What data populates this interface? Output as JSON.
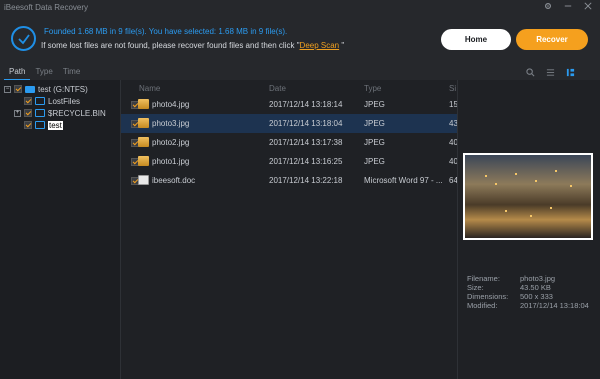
{
  "window": {
    "title": "iBeesoft Data Recovery",
    "controls": [
      "gear-icon",
      "minimize-icon",
      "close-icon"
    ]
  },
  "header": {
    "found_text": "Founded 1.68 MB in 9 file(s).   You have selected: 1.68 MB in 9 file(s).",
    "hint_text": "If some lost files are not found, please recover found files and then click \"",
    "deep_scan_label": "Deep Scan",
    "hint_suffix": " \"",
    "home_label": "Home",
    "recover_label": "Recover",
    "accent": "#2b9bf0",
    "recover_color": "#f5a01e"
  },
  "toolbar": {
    "tabs": [
      {
        "label": "Path",
        "active": true
      },
      {
        "label": "Type",
        "active": false
      },
      {
        "label": "Time",
        "active": false
      }
    ],
    "view_icons": [
      "search-icon",
      "list-view-icon",
      "grid-view-icon"
    ]
  },
  "tree": {
    "root_label": "test (G:NTFS)",
    "children": [
      {
        "label": "LostFiles"
      },
      {
        "label": "$RECYCLE.BIN"
      },
      {
        "label": "test"
      }
    ]
  },
  "filelist": {
    "columns": [
      "Name",
      "Date",
      "Type",
      "Si"
    ],
    "rows": [
      {
        "name": "photo4.jpg",
        "date": "2017/12/14 13:18:14",
        "type": "JPEG",
        "size": "15",
        "kind": "jpg",
        "selected": false
      },
      {
        "name": "photo3.jpg",
        "date": "2017/12/14 13:18:04",
        "type": "JPEG",
        "size": "43",
        "kind": "jpg",
        "selected": true
      },
      {
        "name": "photo2.jpg",
        "date": "2017/12/14 13:17:38",
        "type": "JPEG",
        "size": "40",
        "kind": "jpg",
        "selected": false
      },
      {
        "name": "photo1.jpg",
        "date": "2017/12/14 13:16:25",
        "type": "JPEG",
        "size": "40",
        "kind": "jpg",
        "selected": false
      },
      {
        "name": "ibeesoft.doc",
        "date": "2017/12/14 13:22:18",
        "type": "Microsoft Word 97 - ...",
        "size": "64",
        "kind": "doc",
        "selected": false
      }
    ]
  },
  "preview": {
    "filename_label": "Filename:",
    "filename": "photo3.jpg",
    "size_label": "Size:",
    "size": "43.50 KB",
    "dimensions_label": "Dimensions:",
    "dimensions": "500 x 333",
    "modified_label": "Modified:",
    "modified": "2017/12/14 13:18:04"
  }
}
